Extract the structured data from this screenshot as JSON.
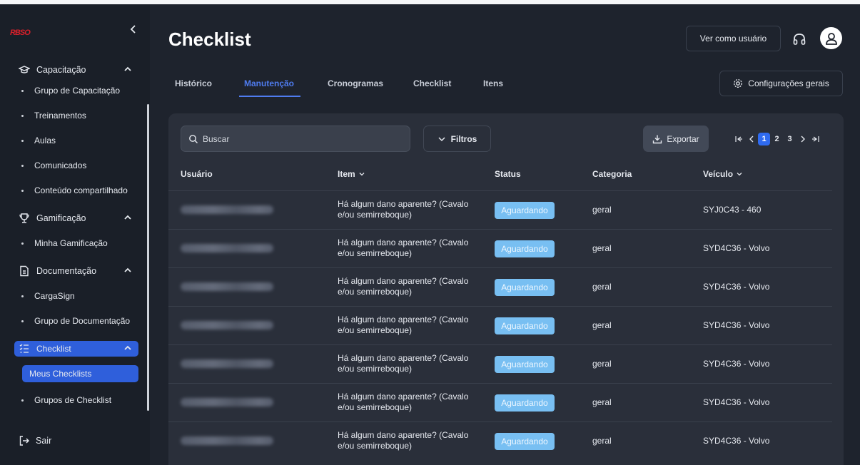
{
  "sidebar": {
    "logo": "RBSO",
    "sections": [
      {
        "label": "Capacitação",
        "icon": "graduation-cap-icon"
      },
      {
        "label": "Gamificação",
        "icon": "trophy-icon"
      },
      {
        "label": "Documentação",
        "icon": "document-icon"
      },
      {
        "label": "Checklist",
        "icon": "checklist-icon"
      }
    ],
    "items": [
      {
        "label": "Grupo de Capacitação"
      },
      {
        "label": "Treinamentos"
      },
      {
        "label": "Aulas"
      },
      {
        "label": "Comunicados"
      },
      {
        "label": "Conteúdo compartilhado"
      },
      {
        "label": "Minha Gamificação"
      },
      {
        "label": "CargaSign"
      },
      {
        "label": "Grupo de Documentação"
      },
      {
        "label": "Meus Checklists"
      },
      {
        "label": "Grupos de Checklist"
      }
    ],
    "logout": "Sair"
  },
  "header": {
    "title": "Checklist",
    "view_as_user": "Ver como usuário",
    "settings": "Configurações gerais"
  },
  "tabs": [
    "Histórico",
    "Manutenção",
    "Cronogramas",
    "Checklist",
    "Itens"
  ],
  "active_tab": "Manutenção",
  "toolbar": {
    "search_placeholder": "Buscar",
    "filters": "Filtros",
    "export": "Exportar"
  },
  "pagination": {
    "pages": [
      "1",
      "2",
      "3"
    ],
    "current": "1"
  },
  "table": {
    "columns": [
      "Usuário",
      "Item",
      "Status",
      "Categoria",
      "Veículo"
    ],
    "rows": [
      {
        "item": "Há algum dano aparente? (Cavalo e/ou semirreboque)",
        "status": "Aguardando",
        "category": "geral",
        "vehicle": "SYJ0C43 - 460"
      },
      {
        "item": "Há algum dano aparente? (Cavalo e/ou semirreboque)",
        "status": "Aguardando",
        "category": "geral",
        "vehicle": "SYD4C36 - Volvo"
      },
      {
        "item": "Há algum dano aparente? (Cavalo e/ou semirreboque)",
        "status": "Aguardando",
        "category": "geral",
        "vehicle": "SYD4C36 - Volvo"
      },
      {
        "item": "Há algum dano aparente? (Cavalo e/ou semirreboque)",
        "status": "Aguardando",
        "category": "geral",
        "vehicle": "SYD4C36 - Volvo"
      },
      {
        "item": "Há algum dano aparente? (Cavalo e/ou semirreboque)",
        "status": "Aguardando",
        "category": "geral",
        "vehicle": "SYD4C36 - Volvo"
      },
      {
        "item": "Há algum dano aparente? (Cavalo e/ou semirreboque)",
        "status": "Aguardando",
        "category": "geral",
        "vehicle": "SYD4C36 - Volvo"
      },
      {
        "item": "Há algum dano aparente? (Cavalo e/ou semirreboque)",
        "status": "Aguardando",
        "category": "geral",
        "vehicle": "SYD4C36 - Volvo"
      }
    ]
  },
  "colors": {
    "accent": "#2f5fdb",
    "status_badge": "#78bff2",
    "background": "#1e232d",
    "panel": "#2a2f3a"
  }
}
